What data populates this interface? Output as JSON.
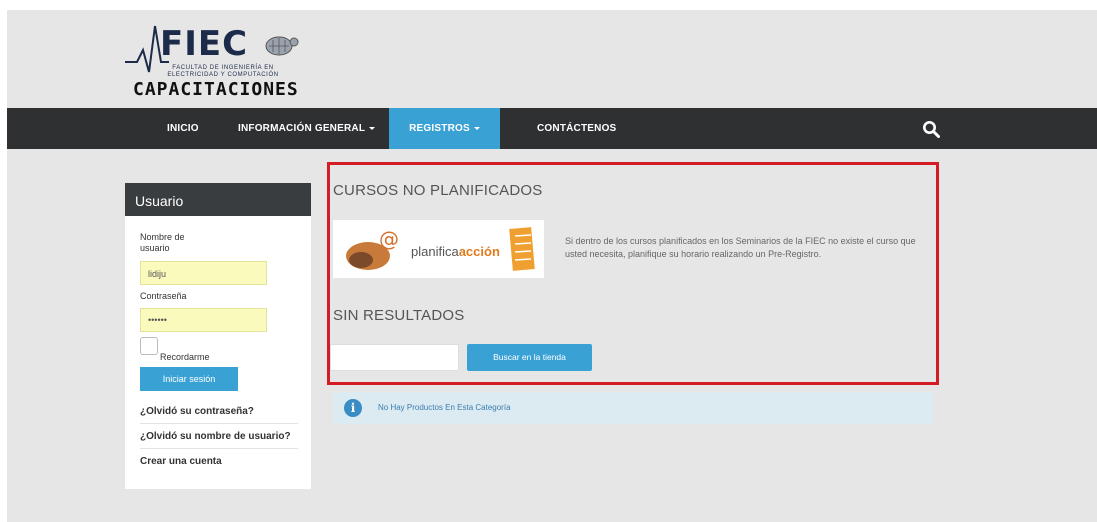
{
  "logo": {
    "title": "FIEC",
    "subtitle_line1": "FACULTAD DE INGENIERÍA EN",
    "subtitle_line2": "ELECTRICIDAD Y COMPUTACIÓN",
    "caption": "CAPACITACIONES"
  },
  "nav": {
    "items": [
      {
        "label": "INICIO",
        "dropdown": false,
        "active": false
      },
      {
        "label": "INFORMACIÓN GENERAL",
        "dropdown": true,
        "active": false
      },
      {
        "label": "REGISTROS",
        "dropdown": true,
        "active": true
      },
      {
        "label": "CONTÁCTENOS",
        "dropdown": false,
        "active": false
      }
    ],
    "search_icon": "search-icon",
    "active_color": "#3aa1d5",
    "bar_color": "#2f3032"
  },
  "login": {
    "title": "Usuario",
    "username_label_1": "Nombre de",
    "username_label_2": "usuario",
    "username_value": "lidiju",
    "password_label": "Contraseña",
    "password_value": "••••••",
    "remember_label": "Recordarme",
    "submit_label": "Iniciar sesión",
    "links": [
      "¿Olvidó su contraseña?",
      "¿Olvidó su nombre de usuario?",
      "Crear una cuenta"
    ]
  },
  "content": {
    "section1_title": "CURSOS NO PLANIFICADOS",
    "banner_text_a": "planifica",
    "banner_text_b": "acción",
    "description": "Si dentro de los cursos planificados en los Seminarios de la FIEC no existe el curso que usted necesita, planifique su horario realizando un Pre-Registro.",
    "section2_title": "SIN RESULTADOS",
    "search_value": "",
    "search_button": "Buscar en la tienda",
    "info_message": "No Hay Productos En Esta Categoría",
    "highlight_color": "#d41c24"
  }
}
